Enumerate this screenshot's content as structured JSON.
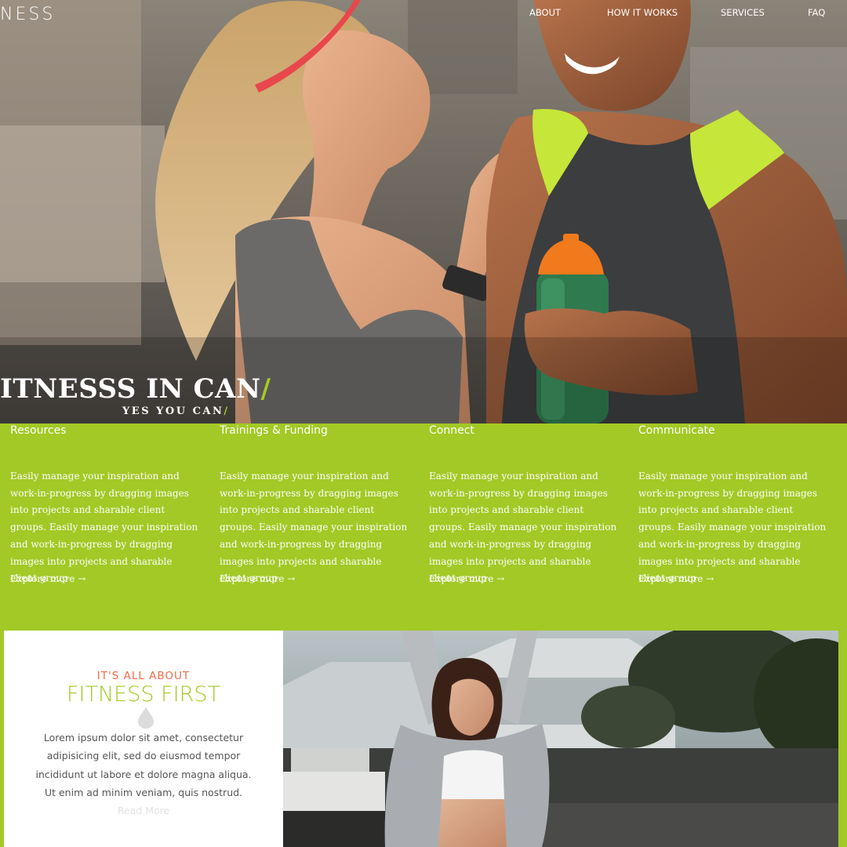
{
  "header": {
    "brand": "NESS",
    "nav": [
      "ABOUT",
      "HOW IT WORKS",
      "SERVICES",
      "FAQ"
    ]
  },
  "hero": {
    "title": "ITNESSS IN CAN",
    "title_slash": "/",
    "subtitle": "YES YOU CAN",
    "subtitle_slash": "/",
    "image": "couple-running-photo"
  },
  "features": [
    {
      "title": "Resources",
      "body": "Easily manage your inspiration and work-in-progress by dragging images into projects and sharable client groups. Easily manage your inspiration and work-in-progress by dragging images into projects and sharable client group",
      "link": "Explore more",
      "arrow": "→"
    },
    {
      "title": "Trainings & Funding",
      "body": "Easily manage your inspiration and work-in-progress by dragging images into projects and sharable client groups. Easily manage your inspiration and work-in-progress by dragging images into projects and sharable client group",
      "link": "Explore more",
      "arrow": "→"
    },
    {
      "title": "Connect",
      "body": "Easily manage your inspiration and work-in-progress by dragging images into projects and sharable client groups. Easily manage your inspiration and work-in-progress by dragging images into projects and sharable client group",
      "link": "Explore more",
      "arrow": "→"
    },
    {
      "title": "Communicate",
      "body": "Easily manage your inspiration and work-in-progress by dragging images into projects and sharable client groups. Easily manage your inspiration and work-in-progress by dragging images into projects and sharable client group",
      "link": "Explore more",
      "arrow": "→"
    }
  ],
  "about": {
    "eyebrow": "IT'S ALL ABOUT",
    "title": "FITNESS FIRST",
    "text": "Lorem ipsum dolor sit amet, consectetur adipisicing elit, sed do eiusmod tempor incididunt ut labore et dolore magna aliqua. Ut enim ad minim veniam, quis nostrud.",
    "read_more": "Read More",
    "icon": "water-drop-icon",
    "image": "woman-stretching-photo"
  },
  "colors": {
    "accent_green": "#a2c925",
    "accent_orange": "#f06a4a",
    "text_gray": "#555555"
  }
}
